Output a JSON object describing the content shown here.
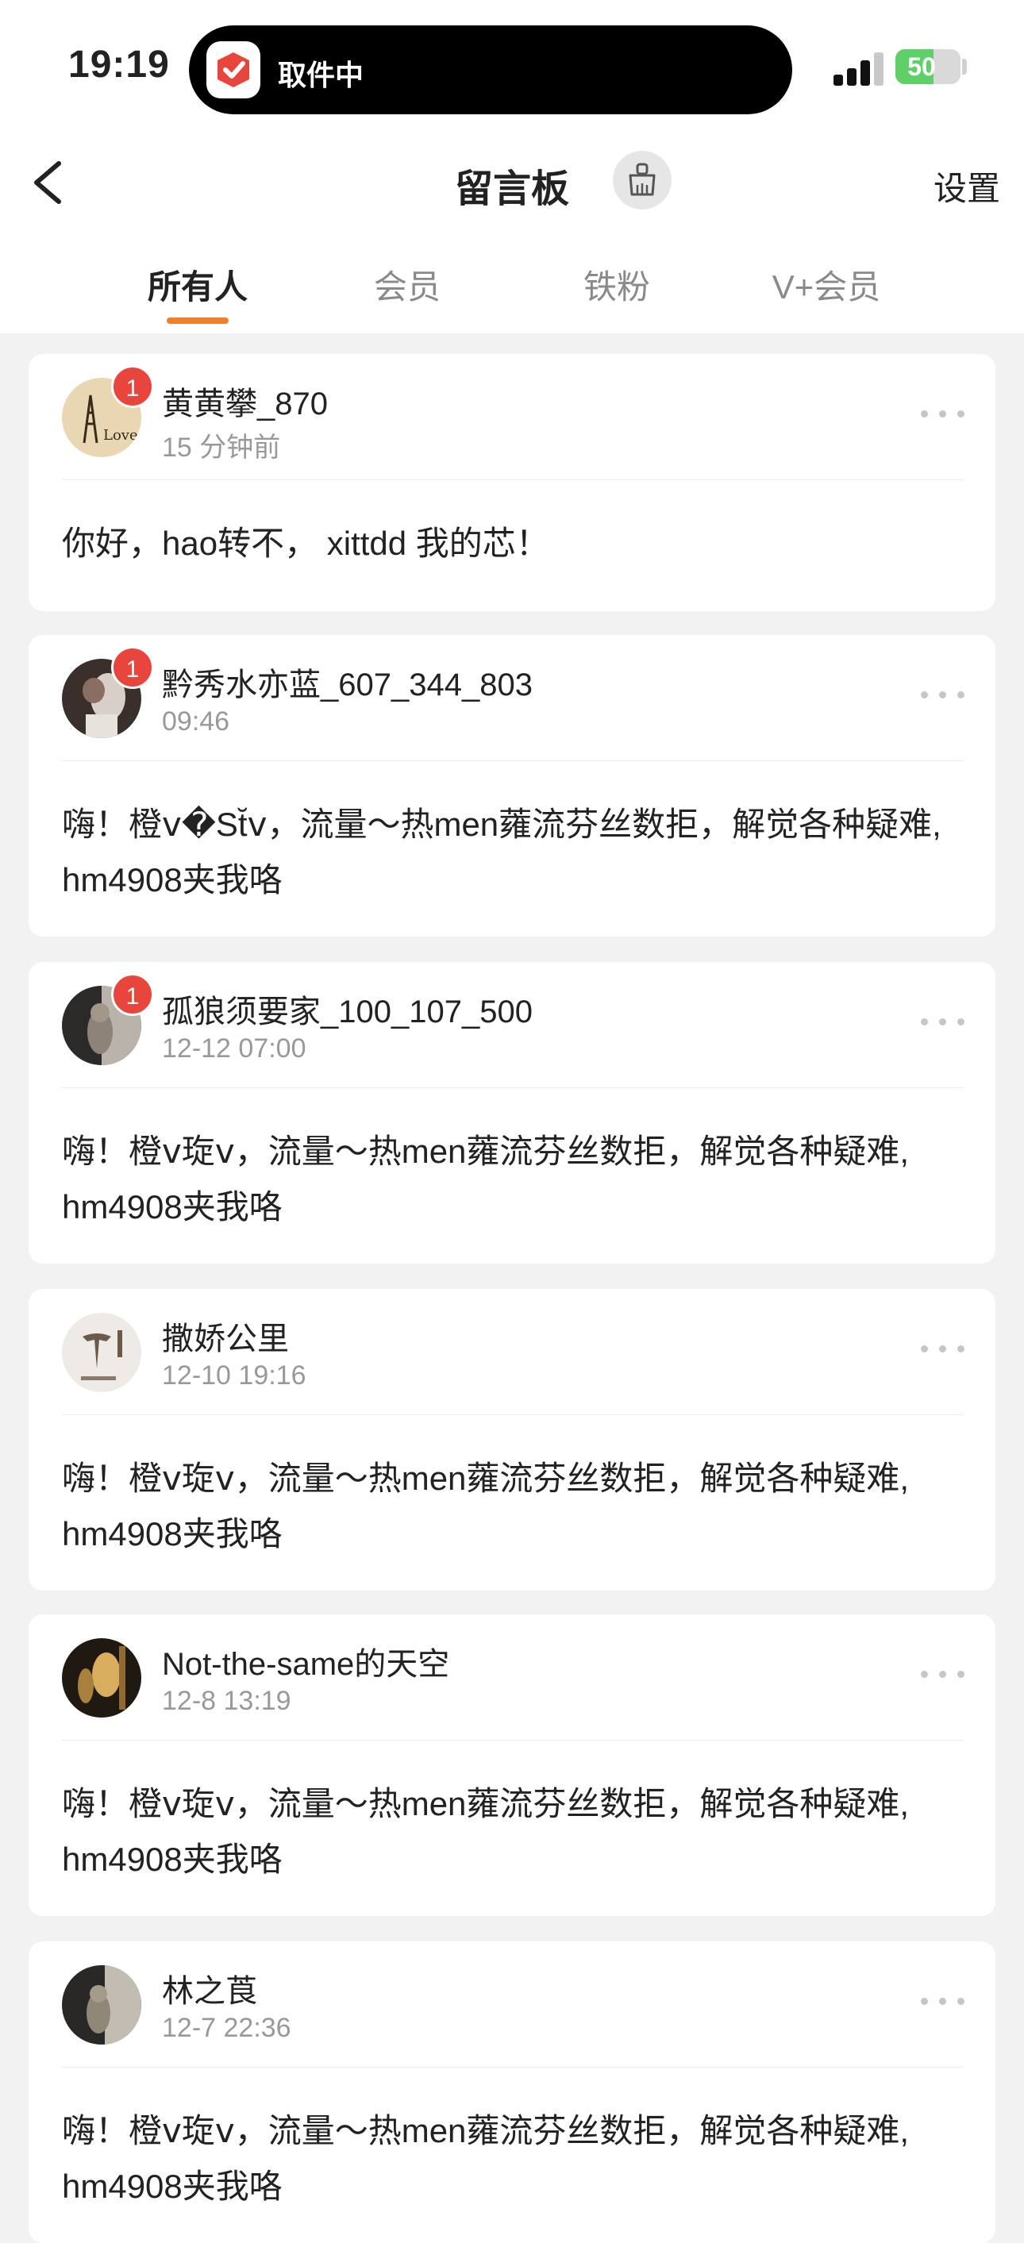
{
  "status_bar": {
    "time": "19:19",
    "live_activity": "取件中",
    "battery": "50"
  },
  "nav": {
    "title": "留言板",
    "settings_label": "设置"
  },
  "tabs": [
    {
      "label": "所有人",
      "active": true
    },
    {
      "label": "会员",
      "active": false
    },
    {
      "label": "铁粉",
      "active": false
    },
    {
      "label": "V+会员",
      "active": false
    }
  ],
  "accent_color": "#f0812a",
  "badge_color": "#e8453c",
  "messages": [
    {
      "username": "黄黄攀_870",
      "time": "15 分钟前",
      "badge": "1",
      "text": "你好，hao转不， xittdd  我的芯！"
    },
    {
      "username": "黔秀水亦蓝_607_344_803",
      "time": "09:46",
      "badge": "1",
      "text": "嗨！橙ⅴ�St̆ⅴ，流量～热men蕹流芬丝数拒，解觉各种疑难, hm4908夹我咯"
    },
    {
      "username": "孤狼须要家_100_107_500",
      "time": "12-12 07:00",
      "badge": "1",
      "text": "嗨！橙ⅴ琁ⅴ，流量～热men蕹流芬丝数拒，解觉各种疑难, hm4908夹我咯"
    },
    {
      "username": "撒娇公里",
      "time": "12-10 19:16",
      "badge": "",
      "text": "嗨！橙ⅴ琁ⅴ，流量～热men蕹流芬丝数拒，解觉各种疑难, hm4908夹我咯"
    },
    {
      "username": "Not-the-same的天空",
      "time": "12-8 13:19",
      "badge": "",
      "text": "嗨！橙ⅴ琁ⅴ，流量～热men蕹流芬丝数拒，解觉各种疑难, hm4908夹我咯"
    },
    {
      "username": "林之莨",
      "time": "12-7 22:36",
      "badge": "",
      "text": "嗨！橙ⅴ琁ⅴ，流量～热men蕹流芬丝数拒，解觉各种疑难, hm4908夹我咯"
    }
  ]
}
